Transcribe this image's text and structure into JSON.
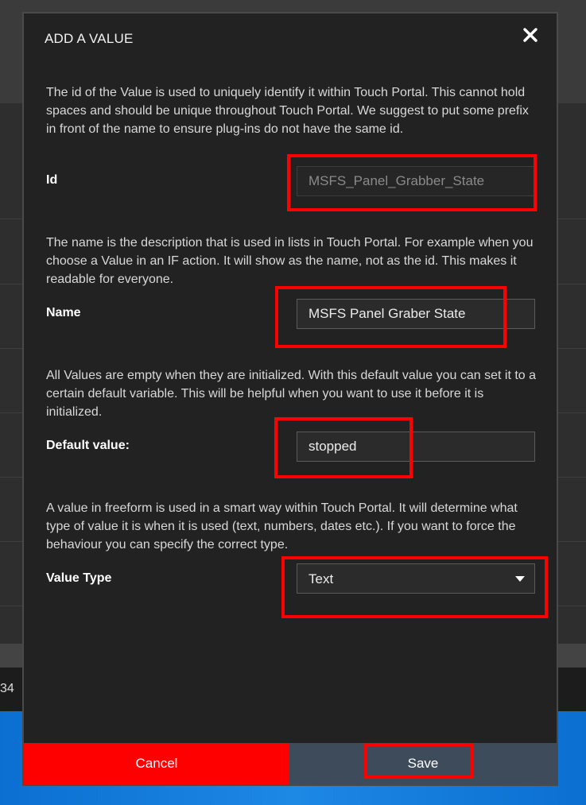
{
  "background": {
    "strip_text": "34"
  },
  "dialog": {
    "title": "ADD A VALUE",
    "close_icon": "close-icon",
    "id_section": {
      "description": "The id of the Value is used to uniquely identify it within Touch Portal. This cannot hold spaces and should be unique throughout Touch Portal. We suggest to put some prefix in front of the name to ensure plug-ins do not have the same id.",
      "label": "Id",
      "value": "MSFS_Panel_Grabber_State"
    },
    "name_section": {
      "description": "The name is the description that is used in lists in Touch Portal. For example when you choose a Value in an IF action. It will show as the name, not as the id. This makes it readable for everyone.",
      "label": "Name",
      "value": "MSFS Panel Graber State"
    },
    "default_section": {
      "description": "All Values are empty when they are initialized. With this default value you can set it to a certain default variable. This will be helpful when you want to use it before it is initialized.",
      "label": "Default value:",
      "value": "stopped"
    },
    "type_section": {
      "description": "A value in freeform is used in a smart way within Touch Portal. It will determine what type of value it is when it is used (text, numbers, dates etc.). If you want to force the behaviour you can specify the correct type.",
      "label": "Value Type",
      "selected": "Text"
    },
    "buttons": {
      "cancel": "Cancel",
      "save": "Save"
    }
  },
  "colors": {
    "dialog_bg": "#222222",
    "cancel_bg": "#ff0000",
    "save_bg": "#3d4b5a",
    "highlight": "#ff0000"
  }
}
